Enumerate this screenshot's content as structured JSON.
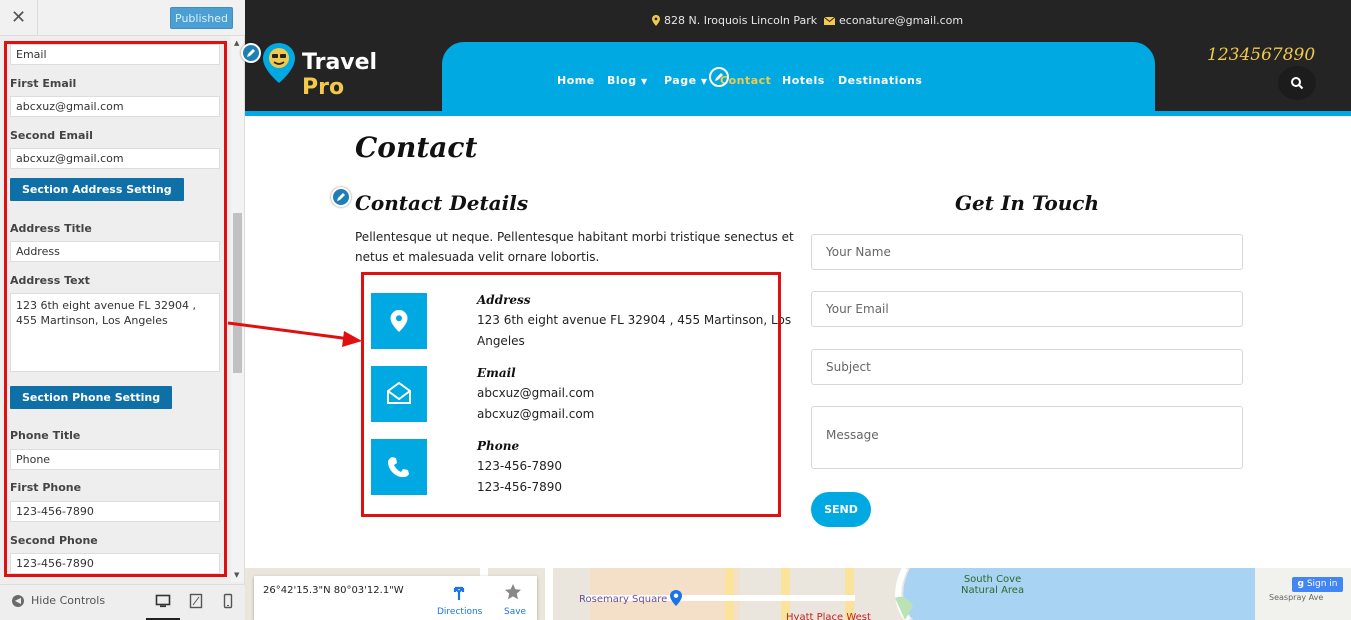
{
  "sidebar": {
    "close_icon": "close-icon",
    "published_label": "Published",
    "email_value": "Email",
    "first_email_label": "First Email",
    "first_email_value": "abcxuz@gmail.com",
    "second_email_label": "Second Email",
    "second_email_value": "abcxuz@gmail.com",
    "section_address_label": "Section Address Setting",
    "address_title_label": "Address Title",
    "address_title_value": "Address",
    "address_text_label": "Address Text",
    "address_text_value": "123 6th eight avenue FL 32904 , 455 Martinson, Los Angeles",
    "section_phone_label": "Section Phone Setting",
    "phone_title_label": "Phone Title",
    "phone_title_value": "Phone",
    "first_phone_label": "First Phone",
    "first_phone_value": "123-456-7890",
    "second_phone_label": "Second Phone",
    "second_phone_value": "123-456-7890",
    "hide_controls_label": "Hide Controls"
  },
  "site": {
    "top_address": "828 N. Iroquois Lincoln Park",
    "top_email": "econature@gmail.com",
    "logo_main": "Travel",
    "logo_accent": "Pro",
    "phone": "1234567890",
    "nav": [
      {
        "label": "Home"
      },
      {
        "label": "Blog"
      },
      {
        "label": "Page"
      },
      {
        "label": "Contact"
      },
      {
        "label": "Hotels"
      },
      {
        "label": "Destinations"
      }
    ],
    "page_title": "Contact",
    "contact_details_title": "Contact Details",
    "intro": "Pellentesque ut neque. Pellentesque habitant morbi tristique senectus et netus et malesuada velit ornare lobortis.",
    "address_title": "Address",
    "address_line1": "123 6th eight avenue FL 32904 , 455 Martinson, Los",
    "address_line2": "Angeles",
    "email_title": "Email",
    "email_line1": "abcxuz@gmail.com",
    "email_line2": "abcxuz@gmail.com",
    "phone_title": "Phone",
    "phone_line1": "123-456-7890",
    "phone_line2": "123-456-7890",
    "get_in_touch": "Get In Touch",
    "form": {
      "name_placeholder": "Your Name",
      "email_placeholder": "Your Email",
      "subject_placeholder": "Subject",
      "message_placeholder": "Message",
      "send_label": "SEND"
    }
  },
  "map": {
    "coords": "26°42'15.3\"N 80°03'12.1\"W",
    "directions_label": "Directions",
    "save_label": "Save",
    "rosemary_label": "Rosemary Square",
    "south_cove_line1": "South Cove",
    "south_cove_line2": "Natural Area",
    "hyatt_label": "Hyatt Place West",
    "seaspray_label": "Seaspray Ave",
    "signin_label": "Sign in"
  },
  "colors": {
    "accent_blue": "#00a9e2",
    "annotation_red": "#e01010",
    "section_button": "#0f70a8",
    "phone_gold": "#f2c94c"
  }
}
